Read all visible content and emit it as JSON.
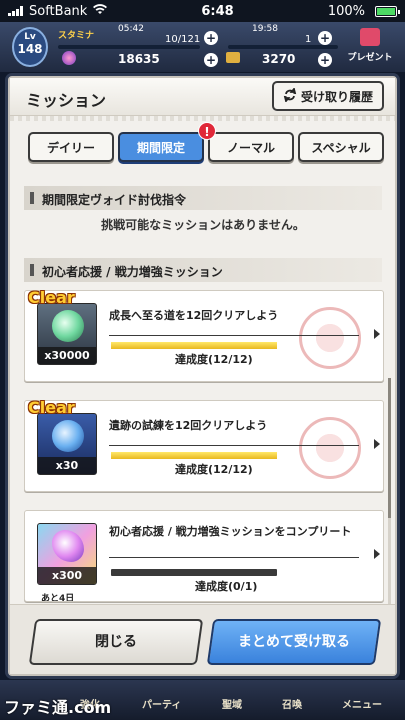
{
  "status": {
    "carrier": "SoftBank",
    "time": "6:48",
    "battery": "100%"
  },
  "header": {
    "lv_label": "Lv",
    "level": "148",
    "stamina_label": "スタミナ",
    "stamina_timer": "05:42",
    "stamina_value": "10/121",
    "gems": "18635",
    "item_timer": "19:58",
    "item_count": "1",
    "coins": "3270",
    "present_label": "プレゼント"
  },
  "dialog": {
    "title": "ミッション",
    "history_button": "受け取り履歴",
    "tabs": [
      {
        "label": "デイリー"
      },
      {
        "label": "期間限定"
      },
      {
        "label": "ノーマル"
      },
      {
        "label": "スペシャル"
      }
    ],
    "alert_badge": "!",
    "section1_title": "期間限定ヴォイド討伐指令",
    "section1_empty": "挑戦可能なミッションはありません。",
    "section2_title": "初心者応援 / 戦力増強ミッション",
    "missions": [
      {
        "clear": "Clear",
        "title": "成長へ至る道を12回クリアしよう",
        "qty": "x30000",
        "progress": "達成度(12/12)",
        "ratio": 1.0
      },
      {
        "clear": "Clear",
        "title": "遺跡の試練を12回クリアしよう",
        "qty": "x30",
        "progress": "達成度(12/12)",
        "ratio": 1.0
      },
      {
        "clear": "",
        "title": "初心者応援 / 戦力増強ミッションをコンプリート",
        "qty": "x300",
        "progress": "達成度(0/1)",
        "ratio": 0.0,
        "remaining": "あと4日"
      }
    ],
    "close_button": "閉じる",
    "bulk_button": "まとめて受け取る"
  },
  "nav": {
    "items": [
      "強化",
      "パーティ",
      "聖域",
      "召喚",
      "メニュー"
    ]
  },
  "watermark": "ファミ通.com",
  "colors": {
    "tab_active": "#4a8ee0",
    "progress_fill": "#f0c830",
    "clear_text": "#ffcc33",
    "badge": "#e02838",
    "bulk_button": "#4a92e6"
  }
}
